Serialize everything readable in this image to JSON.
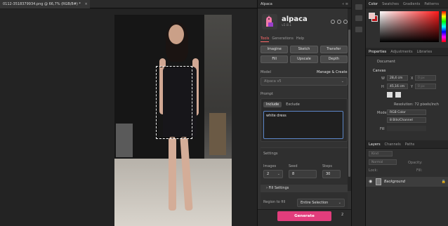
{
  "document": {
    "tab_title": "0112-3518379934.png @ 66,7% (RGB/8#) *",
    "close_glyph": "×"
  },
  "plugin": {
    "tab_title": "Alpaca",
    "tab_controls": "«  ≡",
    "brand": "alpaca",
    "version": "v2.8.1",
    "subtabs": [
      "Tools",
      "Generations",
      "Help"
    ],
    "tools": [
      "Imagine",
      "Sketch",
      "Transfer",
      "Fill",
      "Upscale",
      "Depth"
    ],
    "model_label": "Model",
    "model_link": "Manage & Create",
    "model_value": "Alpaca v5",
    "prompt_label": "Prompt",
    "prompt_tabs": [
      "Include",
      "Exclude"
    ],
    "prompt_text": "white dress",
    "settings_label": "Settings",
    "images_label": "Images",
    "images_value": "2",
    "seed_label": "Seed",
    "seed_value": "8",
    "steps_label": "Steps",
    "steps_value": "30",
    "fill_settings": "Fill Settings",
    "region_label": "Region to fill",
    "region_value": "Entire Selection",
    "generate_label": "Generate",
    "generate_count": "2",
    "chevron": "⌄",
    "caret": "›"
  },
  "dock": {
    "color_tabs": [
      "Color",
      "Swatches",
      "Gradients",
      "Patterns"
    ],
    "properties_tabs": [
      "Properties",
      "Adjustments",
      "Libraries"
    ],
    "document_label": "Document",
    "canvas_label": "Canvas",
    "w_label": "W",
    "w_value": "28,4 cm",
    "x_label": "X",
    "x_value": "0 px",
    "h_label": "H",
    "h_value": "45,16 cm",
    "y_label": "Y",
    "y_value": "0 px",
    "resolution": "Resolution: 72 pixels/inch",
    "mode_label": "Mode",
    "mode_value": "RGB Color",
    "depth_value": "8 Bits/Channel",
    "fill_label": "Fill",
    "layers_tabs": [
      "Layers",
      "Channels",
      "Paths"
    ],
    "kind_placeholder": "Kind",
    "blend_value": "Normal",
    "opacity_label": "Opacity:",
    "lock_label": "Lock:",
    "fill_opacity_label": "Fill:",
    "layer_name": "Background",
    "eye_glyph": "◉",
    "lock_glyph": "🔒"
  },
  "colors": {
    "accent": "#e23d7c",
    "active_tab": "#ff6a6a",
    "focus": "#5c86c7"
  }
}
